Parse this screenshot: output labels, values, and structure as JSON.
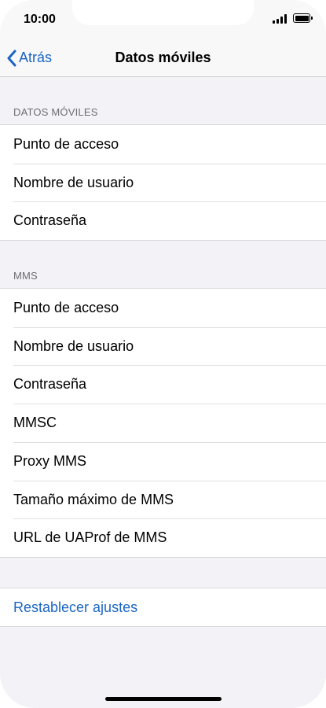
{
  "status_bar": {
    "time": "10:00"
  },
  "nav": {
    "back_label": "Atrás",
    "title": "Datos móviles"
  },
  "sections": [
    {
      "header": "DATOS MÓVILES",
      "items": [
        "Punto de acceso",
        "Nombre de usuario",
        "Contraseña"
      ]
    },
    {
      "header": "MMS",
      "items": [
        "Punto de acceso",
        "Nombre de usuario",
        "Contraseña",
        "MMSC",
        "Proxy MMS",
        "Tamaño máximo de MMS",
        "URL de UAProf de MMS"
      ]
    }
  ],
  "reset_label": "Restablecer ajustes",
  "colors": {
    "accent": "#1a65c5",
    "background": "#f2f2f7"
  }
}
